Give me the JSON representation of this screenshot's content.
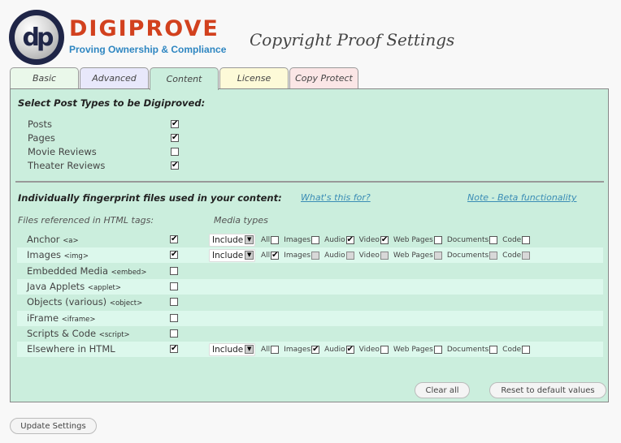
{
  "header": {
    "logo_initials": "dp",
    "brand_name": "DIGIPROVE",
    "brand_tagline": "Proving Ownership & Compliance",
    "page_title": "Copyright Proof Settings"
  },
  "tabs": [
    {
      "label": "Basic",
      "active": false
    },
    {
      "label": "Advanced",
      "active": false
    },
    {
      "label": "Content",
      "active": true
    },
    {
      "label": "License",
      "active": false
    },
    {
      "label": "Copy Protect",
      "active": false
    }
  ],
  "post_types": {
    "title": "Select Post Types to be Digiproved:",
    "items": [
      {
        "label": "Posts",
        "checked": true
      },
      {
        "label": "Pages",
        "checked": true
      },
      {
        "label": "Movie Reviews",
        "checked": false
      },
      {
        "label": "Theater Reviews",
        "checked": true
      }
    ]
  },
  "fingerprint": {
    "title": "Individually fingerprint files used in your content:",
    "help_link": "What's this for?",
    "beta_link": "Note - Beta functionality",
    "col_files": "Files referenced in HTML tags:",
    "col_media": "Media types",
    "media_labels": [
      "All",
      "Images",
      "Audio",
      "Video",
      "Web Pages",
      "Documents",
      "Code"
    ],
    "rows": [
      {
        "label": "Anchor",
        "tag": "<a>",
        "checked": true,
        "mode": "Include",
        "media": [
          false,
          false,
          true,
          true,
          false,
          false,
          false
        ],
        "disabled": false
      },
      {
        "label": "Images",
        "tag": "<img>",
        "checked": true,
        "mode": "Include",
        "media": [
          true,
          false,
          false,
          false,
          false,
          false,
          false
        ],
        "disabled": true
      },
      {
        "label": "Embedded Media",
        "tag": "<embed>",
        "checked": false,
        "mode": null,
        "media": null,
        "disabled": false
      },
      {
        "label": "Java Applets",
        "tag": "<applet>",
        "checked": false,
        "mode": null,
        "media": null,
        "disabled": false
      },
      {
        "label": "Objects (various)",
        "tag": "<object>",
        "checked": false,
        "mode": null,
        "media": null,
        "disabled": false
      },
      {
        "label": "iFrame",
        "tag": "<iframe>",
        "checked": false,
        "mode": null,
        "media": null,
        "disabled": false
      },
      {
        "label": "Scripts & Code",
        "tag": "<script>",
        "checked": false,
        "mode": null,
        "media": null,
        "disabled": false
      },
      {
        "label": "Elsewhere in HTML",
        "tag": "",
        "checked": true,
        "mode": "Include",
        "media": [
          false,
          true,
          true,
          false,
          false,
          false,
          false
        ],
        "disabled": false
      }
    ]
  },
  "buttons": {
    "clear_all": "Clear all",
    "reset": "Reset to default values",
    "update": "Update Settings"
  },
  "icons": {
    "check": "✔",
    "dropdown_arrow": "▼"
  }
}
